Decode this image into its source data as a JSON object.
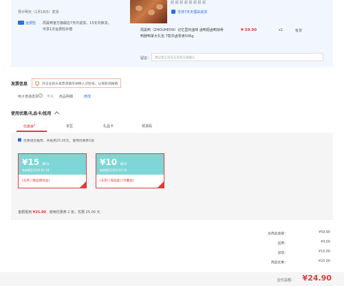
{
  "order": {
    "top_text": "超 超 超 超 超 超 超 超",
    "estimate": "预计明天（1月18日）发货",
    "carrier_name": "运费险",
    "carrier_desc": "周黑鸭官方旗舰店7天内退货、15天内换货，可享1次运费险补偿",
    "return_policy": "支持7天无理由退货",
    "product_title": "周黑鸭（ZHOUHEIYA）记忆里的卤味 卤鸭翅卤鸭锁骨鸭脖鸭掌大礼包 7款共卤零食506g",
    "price": "¥ 59.90",
    "quantity": "x1",
    "stock": "有货",
    "remark_label": "留言：",
    "remark_placeholder": "建议留言前先与商家沟通确认"
  },
  "invoice": {
    "title": "发票信息",
    "tip": "开企业抬头发票须填写纳税人识别号，以免影响报销",
    "type": "电子普通发票",
    "help": "?",
    "person": "个人",
    "detail": "商品明细",
    "edit": "修改"
  },
  "coupons": {
    "title": "使用优惠/礼品卡/抵用",
    "toggle_icon": "chevron-up",
    "tabs": [
      "优惠券",
      "京豆",
      "礼品卡",
      "领货码"
    ],
    "tab_badge": "8",
    "combine_text": "优惠组合推荐，共抵用25.00元，使用优惠券2张",
    "items": [
      {
        "symbol": "¥",
        "amount": "15",
        "unit": "满59",
        "valid": "有效期至2024-01-18",
        "tags": "[东券]  [限品牌商品]"
      },
      {
        "symbol": "¥",
        "amount": "10",
        "unit": "满59",
        "valid": "有效期至2024-01-18",
        "tags": "[东券]  [限品类]  [可叠加]"
      }
    ],
    "deduct_label": "金额抵用",
    "deduct_amount": "¥25.00",
    "deduct_detail": "使用优惠券 2 张，优惠 25.00 元"
  },
  "summary": {
    "rows": [
      {
        "label": "总商品金额：",
        "value": "¥59.90"
      },
      {
        "label": "运费：",
        "value": "¥0.00"
      },
      {
        "label": "返现：",
        "value": "-¥10.00"
      },
      {
        "label": "商品优惠：",
        "value": "-¥25.00"
      }
    ],
    "pay_label": "应付总额：",
    "pay_value": "¥24.90"
  },
  "colors": {
    "accent": "#e4393c",
    "link": "#2d6fe0",
    "coupon": "#7fd6d6",
    "order_bg": "#f2f7ff"
  }
}
